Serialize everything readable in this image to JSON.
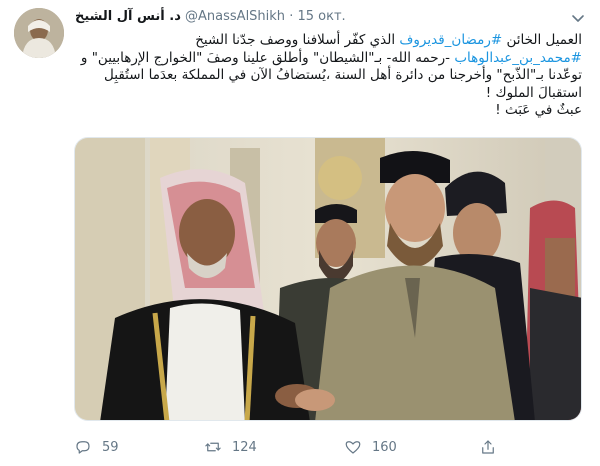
{
  "tweet": {
    "display_name": "د. أنس آل الشيخ",
    "handle": "@AnassAlShikh",
    "separator": "·",
    "date": "15 окт.",
    "text_runs": [
      {
        "t": "العميل الخائن ",
        "tag": false
      },
      {
        "t": "#رمضان_قديروف",
        "tag": true
      },
      {
        "t": " الذي كفّر أسلافنا ووصف جدّنا الشيخ ",
        "tag": false
      },
      {
        "t": "#محمد_بن_عبدالوهاب",
        "tag": true
      },
      {
        "t": " -رحمه الله- بـ\"الشيطان\" وأطلق علينا وصفَ \"الخوارج الإرهابيين\" و توعّدنا بـ\"الذّبح\" وأخرجنا من دائرة أهل السنة ،يُستضافُ الآن في المملكة بعدَما استُقبِل استقبالَ الملوك !",
        "tag": false
      }
    ],
    "last_line": "عبثٌ في عَبَث !",
    "image_alt": "photo",
    "stats": {
      "replies": "59",
      "retweets": "124",
      "likes": "160"
    }
  },
  "icons": {
    "reply": "reply-icon",
    "retweet": "retweet-icon",
    "like": "heart-icon",
    "share": "share-icon",
    "more": "chevron-down-icon"
  },
  "colors": {
    "link": "#1b95e0",
    "muted": "#657786"
  }
}
